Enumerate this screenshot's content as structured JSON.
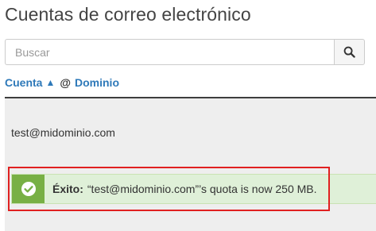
{
  "page": {
    "title": "Cuentas de correo electrónico"
  },
  "search": {
    "placeholder": "Buscar",
    "button_icon": "search-icon"
  },
  "table": {
    "sort_header": {
      "account_label": "Cuenta",
      "sort_indicator": "▲",
      "separator": "@",
      "domain_label": "Dominio"
    },
    "rows": [
      {
        "email": "test@midominio.com"
      }
    ]
  },
  "alert": {
    "type": "success",
    "icon": "check-circle-icon",
    "label": "Éxito:",
    "message": "“test@midominio.com”’s quota is now 250 MB."
  },
  "colors": {
    "link": "#2e79b9",
    "success_icon_bg": "#78b045",
    "success_bg": "#dff0d8",
    "highlight_border": "#e02020",
    "table_bg": "#eeeeee"
  }
}
